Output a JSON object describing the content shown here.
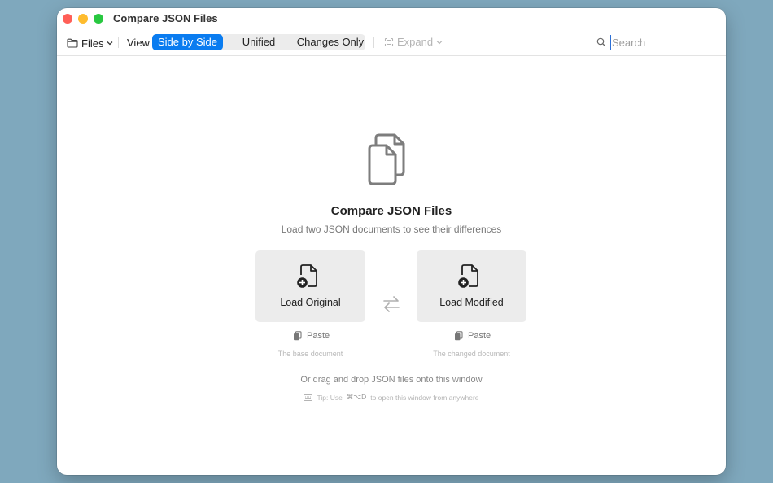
{
  "window": {
    "title": "Compare JSON Files"
  },
  "toolbar": {
    "files_label": "Files",
    "view_label": "View",
    "segments": [
      {
        "label": "Side by Side",
        "active": true
      },
      {
        "label": "Unified",
        "active": false
      },
      {
        "label": "Changes Only",
        "active": false
      }
    ],
    "expand_label": "Expand",
    "search_placeholder": "Search"
  },
  "empty_state": {
    "title": "Compare JSON Files",
    "subtitle": "Load two JSON documents to see their differences",
    "original": {
      "button_label": "Load Original",
      "paste_label": "Paste",
      "caption": "The base document"
    },
    "modified": {
      "button_label": "Load Modified",
      "paste_label": "Paste",
      "caption": "The changed document"
    },
    "drag_hint": "Or drag and drop JSON files onto this window",
    "tip_prefix": "Tip: Use",
    "tip_shortcut": "⌘⌥D",
    "tip_suffix": "to open this window from anywhere"
  },
  "colors": {
    "accent": "#0a7cf0",
    "close": "#ff5f57",
    "minimize": "#febc2e",
    "maximize": "#28c840"
  }
}
